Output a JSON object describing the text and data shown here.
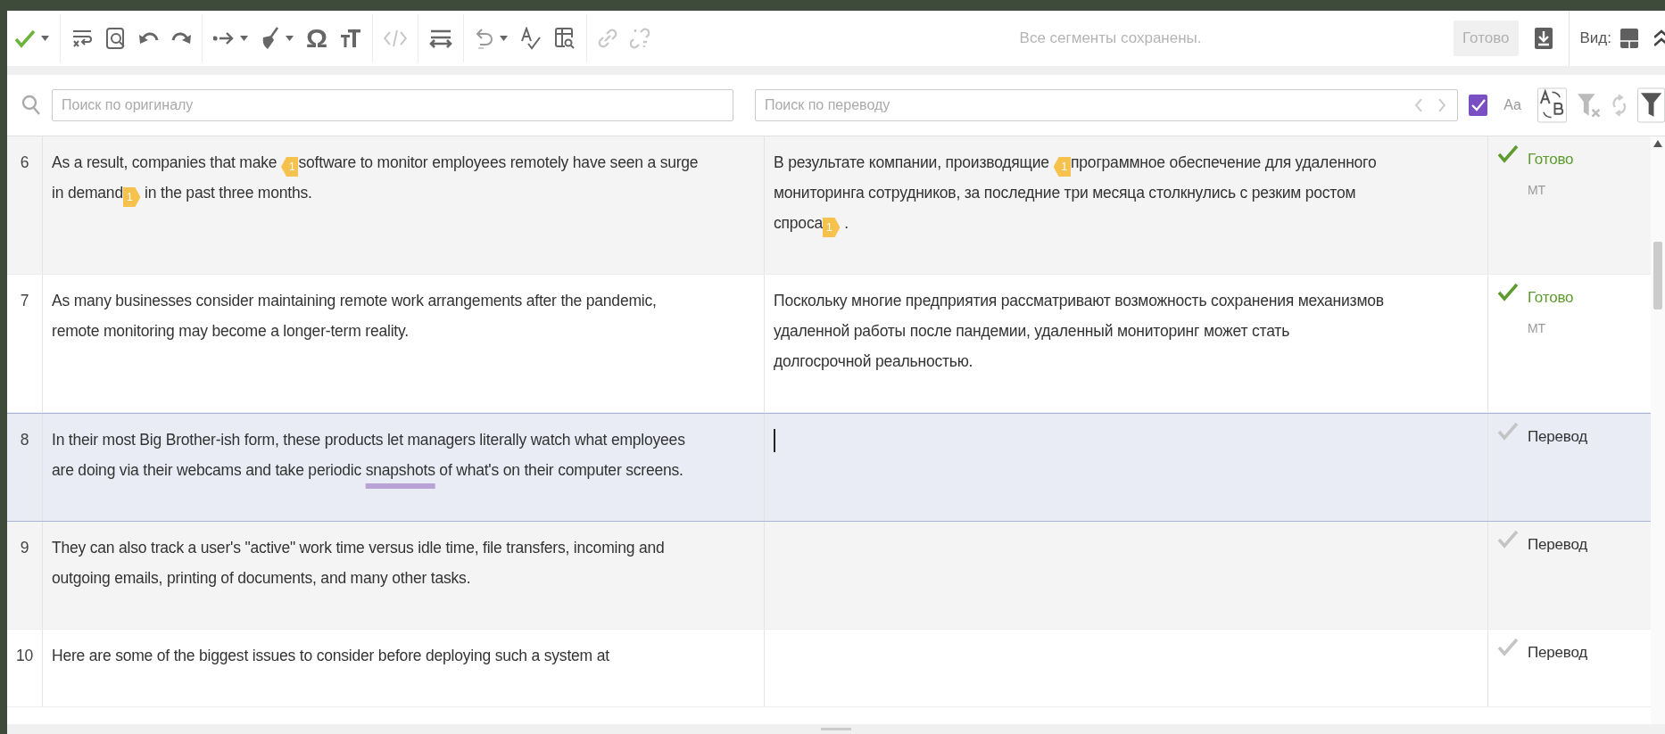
{
  "toolbar": {
    "symbol_button": "Ω",
    "save_status": "Все сегменты сохранены.",
    "done_button": {
      "label": "Готово",
      "disabled": true
    },
    "view_label": "Вид:"
  },
  "search": {
    "source_placeholder": "Поиск по оригиналу",
    "target_placeholder": "Поиск по переводу",
    "filter_checked": true,
    "case_label": "Aa"
  },
  "segments": [
    {
      "number": "6",
      "selected": false,
      "source": [
        {
          "kind": "text",
          "text": "As a result, companies that make "
        },
        {
          "kind": "tag-open",
          "text": "1"
        },
        {
          "kind": "text",
          "text": "software to monitor employees remotely have seen a surge in demand"
        },
        {
          "kind": "tag-close",
          "text": "1"
        },
        {
          "kind": "text",
          "text": " in the past three months."
        }
      ],
      "target": [
        {
          "kind": "text",
          "text": "В результате компании, производящие "
        },
        {
          "kind": "tag-open",
          "text": "1"
        },
        {
          "kind": "text",
          "text": "программное обеспечение для удаленного мониторинга сотрудников, за последние три месяца столкнулись с резким ростом спроса"
        },
        {
          "kind": "tag-close",
          "text": "1"
        },
        {
          "kind": "text",
          "text": " ."
        }
      ],
      "status": "Готово",
      "origin": "MT",
      "confirmed": true
    },
    {
      "number": "7",
      "selected": false,
      "source": [
        {
          "kind": "text",
          "text": "As many businesses consider maintaining remote work arrangements after the pandemic, remote monitoring may become a longer-term reality."
        }
      ],
      "target": [
        {
          "kind": "text",
          "text": "Поскольку многие предприятия рассматривают возможность сохранения механизмов удаленной работы после пандемии, удаленный мониторинг может стать долгосрочной реальностью."
        }
      ],
      "status": "Готово",
      "origin": "MT",
      "confirmed": true
    },
    {
      "number": "8",
      "selected": true,
      "source": [
        {
          "kind": "text",
          "text": "In their most Big Brother-ish form, these products let managers literally watch what employees are doing via their webcams and take periodic "
        },
        {
          "kind": "term",
          "text": "snapshots"
        },
        {
          "kind": "text",
          "text": " of what's on their computer screens."
        }
      ],
      "status": "Перевод",
      "confirmed": false
    },
    {
      "number": "9",
      "selected": false,
      "source": [
        {
          "kind": "text",
          "text": "They can also track a user's \"active\" work time versus idle time, file transfers, incoming and outgoing emails, printing of documents, and many other tasks."
        }
      ],
      "status": "Перевод",
      "confirmed": false
    },
    {
      "number": "10",
      "selected": false,
      "source": [
        {
          "kind": "text",
          "text": "Here are some of the biggest issues to consider before deploying such a system at"
        }
      ],
      "status": "Перевод",
      "confirmed": false
    }
  ]
}
